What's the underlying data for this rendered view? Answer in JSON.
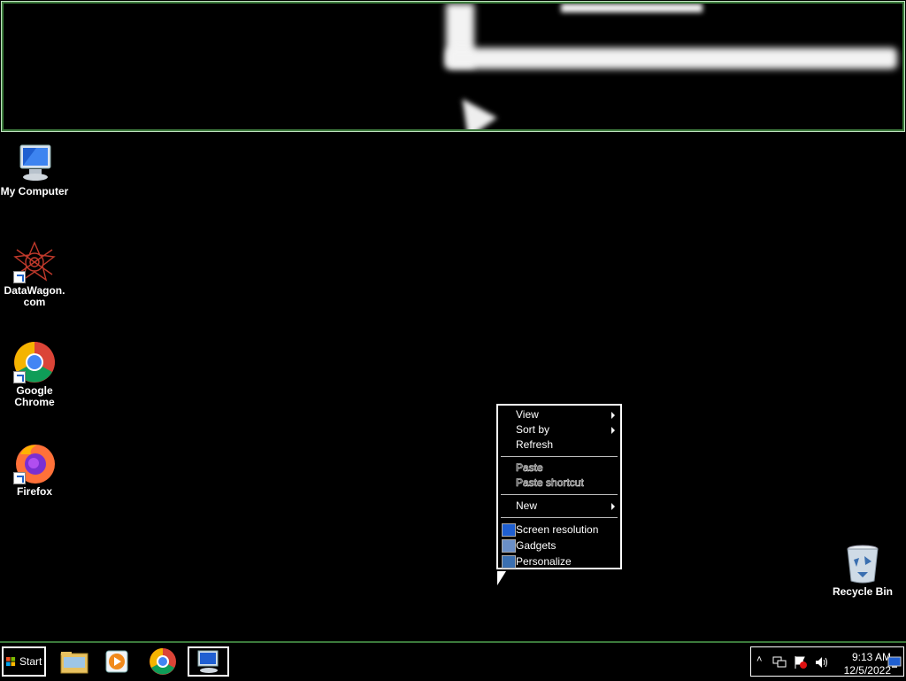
{
  "desktop": {
    "icons": [
      {
        "label": "My Computer",
        "icon": "computer-icon"
      },
      {
        "label": "DataWagon.\ncom",
        "line1": "DataWagon.",
        "line2": "com",
        "icon": "datawagon-icon"
      },
      {
        "label": "Google Chrome",
        "line1": "Google",
        "line2": "Chrome",
        "icon": "chrome-icon"
      },
      {
        "label": "Firefox",
        "icon": "firefox-icon"
      },
      {
        "label": "Recycle Bin",
        "icon": "recycle-bin-icon"
      }
    ]
  },
  "context_menu": {
    "view": "View",
    "sort_by": "Sort by",
    "refresh": "Refresh",
    "paste": "Paste",
    "paste_shortcut": "Paste shortcut",
    "new": "New",
    "screen_resolution": "Screen resolution",
    "gadgets": "Gadgets",
    "personalize": "Personalize"
  },
  "taskbar": {
    "start_label": "Start",
    "apps": [
      "file-explorer-icon",
      "media-player-icon",
      "chrome-icon",
      "remote-desktop-icon"
    ],
    "time": "9:13 AM",
    "date": "12/5/2022"
  },
  "colors": {
    "background": "#000000",
    "accent_border": "#3c7a3c",
    "text": "#ffffff"
  }
}
